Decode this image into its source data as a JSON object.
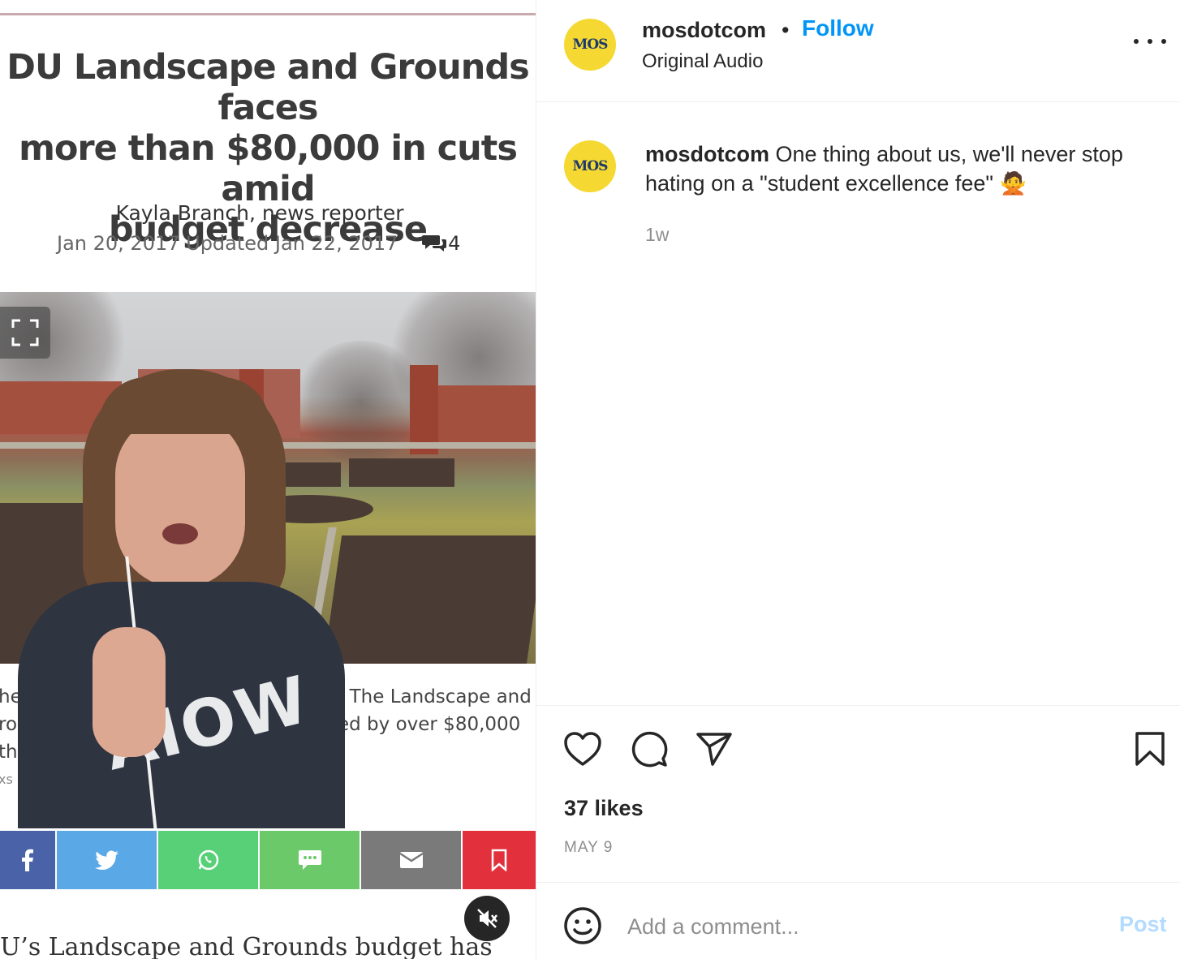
{
  "video": {
    "headline_lines": [
      "DU Landscape and Grounds faces",
      "more than $80,000 in cuts amid",
      "budget decrease"
    ],
    "byline": "Kayla Branch, news reporter",
    "dateline": "Jan 20, 2017 Updated Jan 22, 2017",
    "comment_count": "4",
    "caption_left_lines": [
      "he",
      "ro",
      "th",
      "xs"
    ],
    "caption_right_lines": [
      ". The Landscape and",
      "ed by over $80,000"
    ],
    "sweater_text": "AIOW",
    "body_text": "U’s Landscape and Grounds budget has",
    "share_buttons": [
      {
        "name": "facebook",
        "color": "#4a63a8"
      },
      {
        "name": "twitter",
        "color": "#5aa9e6"
      },
      {
        "name": "whatsapp",
        "color": "#57d077"
      },
      {
        "name": "sms",
        "color": "#6cc96a"
      },
      {
        "name": "email",
        "color": "#7a7a7a"
      },
      {
        "name": "bookmark",
        "color": "#e2313c"
      }
    ]
  },
  "post": {
    "header": {
      "avatar_text": "MOS",
      "username": "mosdotcom",
      "separator": "•",
      "follow_label": "Follow",
      "subtitle": "Original Audio"
    },
    "caption": {
      "avatar_text": "MOS",
      "username": "mosdotcom",
      "text": "One thing about us, we'll never stop hating on a \"student excellence fee\" 🙅"
    },
    "age": "1w",
    "likes": "37 likes",
    "date": "MAY 9",
    "comment_placeholder": "Add a comment...",
    "post_label": "Post",
    "accent_color": "#0095f6"
  }
}
